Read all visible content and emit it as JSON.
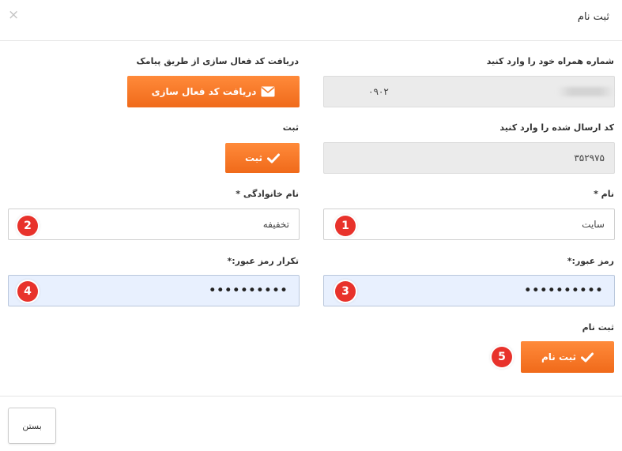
{
  "dialog": {
    "title": "ثبت نام",
    "close_icon": "×"
  },
  "phone": {
    "label": "شماره همراه خود را وارد کنید",
    "value": "۰۹۰۲"
  },
  "sms_code": {
    "label": "دریافت کد فعال سازی از طریق پیامک",
    "button_label": "دریافت کد فعال سازی",
    "icon": "envelope-icon"
  },
  "code": {
    "label": "کد ارسال شده را وارد کنید",
    "value": "۳۵۲۹۷۵"
  },
  "verify": {
    "label": "ثبت",
    "button_label": "ثبت",
    "icon": "check-icon"
  },
  "first_name": {
    "label": "نام *",
    "value": "سایت",
    "badge": "1"
  },
  "last_name": {
    "label": "نام خانوادگی *",
    "value": "تخفیفه",
    "badge": "2"
  },
  "password": {
    "label": "رمز عبور:*",
    "dots": "••••••••••",
    "badge": "3"
  },
  "password_repeat": {
    "label": "تکرار رمز عبور:*",
    "dots": "••••••••••",
    "badge": "4"
  },
  "register": {
    "label": "ثبت نام",
    "button_label": "ثبت نام",
    "icon": "check-icon",
    "badge": "5"
  },
  "footer": {
    "close_label": "بستن"
  },
  "colors": {
    "accent": "#f47a2a",
    "badge": "#e8322b",
    "password_bg": "#e8f0fe",
    "readonly_bg": "#ebebeb"
  }
}
